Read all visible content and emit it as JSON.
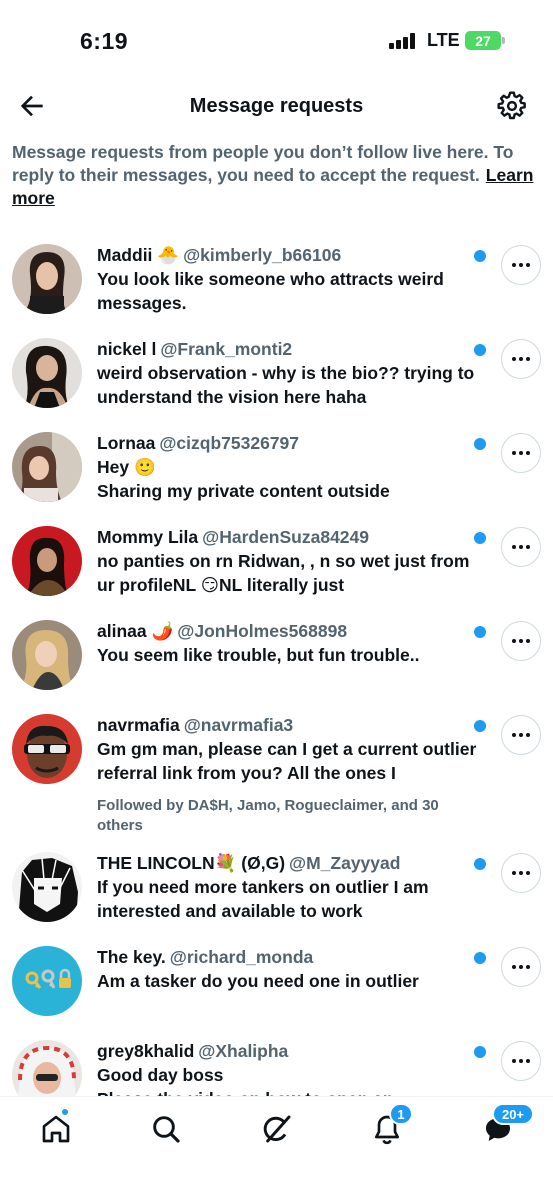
{
  "status_bar": {
    "time": "6:19",
    "network": "LTE",
    "battery": "27"
  },
  "header": {
    "title": "Message requests",
    "back_icon": "arrow-left-icon",
    "settings_icon": "gear-icon"
  },
  "info": {
    "text": "Message requests from people you don’t follow live here. To reply to their messages, you need to accept the request.",
    "link": "Learn more"
  },
  "requests": [
    {
      "name": "Maddii 🐣",
      "handle": "@kimberly_b66106",
      "message": "You look like someone who attracts weird messages.",
      "followed": ""
    },
    {
      "name": "nickel l",
      "handle": "@Frank_monti2",
      "message": "weird observation - why is the bio?? trying to understand the vision here haha",
      "followed": ""
    },
    {
      "name": "Lornaa",
      "handle": "@cizqb75326797",
      "message": "Hey 🙂\nSharing my private content outside",
      "followed": ""
    },
    {
      "name": "Mommy Lila",
      "handle": "@HardenSuza84249",
      "message": "no panties on rn Ridwan,  , n  so wet just from ur profileNL 😏NL literally just",
      "followed": ""
    },
    {
      "name": "alinaa 🌶️",
      "handle": "@JonHolmes568898",
      "message": "You seem like trouble, but fun trouble..",
      "followed": ""
    },
    {
      "name": "navrmafia",
      "handle": "@navrmafia3",
      "message": "Gm gm man, please can I get a current outlier referral link from you? All the ones I",
      "followed": "Followed by DA$H, Jamo, Rogueclaimer, and 30 others"
    },
    {
      "name": "THE LINCOLN💐 (Ø,G)",
      "handle": "@M_Zayyyad",
      "message": "If you need more tankers on outlier I am interested and available to work",
      "followed": ""
    },
    {
      "name": "The key.",
      "handle": "@richard_monda",
      "message": "Am a tasker do you need one in outlier",
      "followed": ""
    },
    {
      "name": "grey8khalid",
      "handle": "@Xhalipha",
      "message": "Good day boss\nPlease the video on how to open an",
      "followed": ""
    }
  ],
  "bottom_nav": {
    "items": [
      {
        "icon": "home-icon"
      },
      {
        "icon": "search-icon"
      },
      {
        "icon": "grok-icon"
      },
      {
        "icon": "bell-icon",
        "badge": "1"
      },
      {
        "icon": "messages-icon",
        "badge": "20+"
      }
    ]
  }
}
